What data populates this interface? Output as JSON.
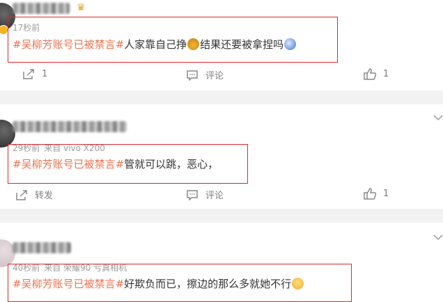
{
  "posts": [
    {
      "time": "17秒前",
      "source": "",
      "tag": "#吴柳芳账号已被禁言#",
      "text_before_emoji1": "人家靠自己挣",
      "text_between": "结果还要被拿捏吗",
      "emoji1": "money-bag-emoji",
      "emoji2": "sly-face-emoji",
      "actions": {
        "share": "1",
        "comment": "评论",
        "like": "1"
      }
    },
    {
      "time": "29秒前",
      "source": "来自 vivo X200",
      "tag": "#吴柳芳账号已被禁言#",
      "text": "管就可以跳，恶心，",
      "actions": {
        "share": "转发",
        "comment": "评论",
        "like": "1"
      }
    },
    {
      "time": "40秒前",
      "source": "来自 荣耀90 亏真相机",
      "tag": "#吴柳芳账号已被禁言#",
      "text": "好欺负而已，擦边的那么多就她不行",
      "emoji": "shrug-emoji"
    }
  ],
  "colors": {
    "tag": "#eb7350",
    "highlight_box": "#e0262b",
    "divider": "#f2f2f2"
  }
}
